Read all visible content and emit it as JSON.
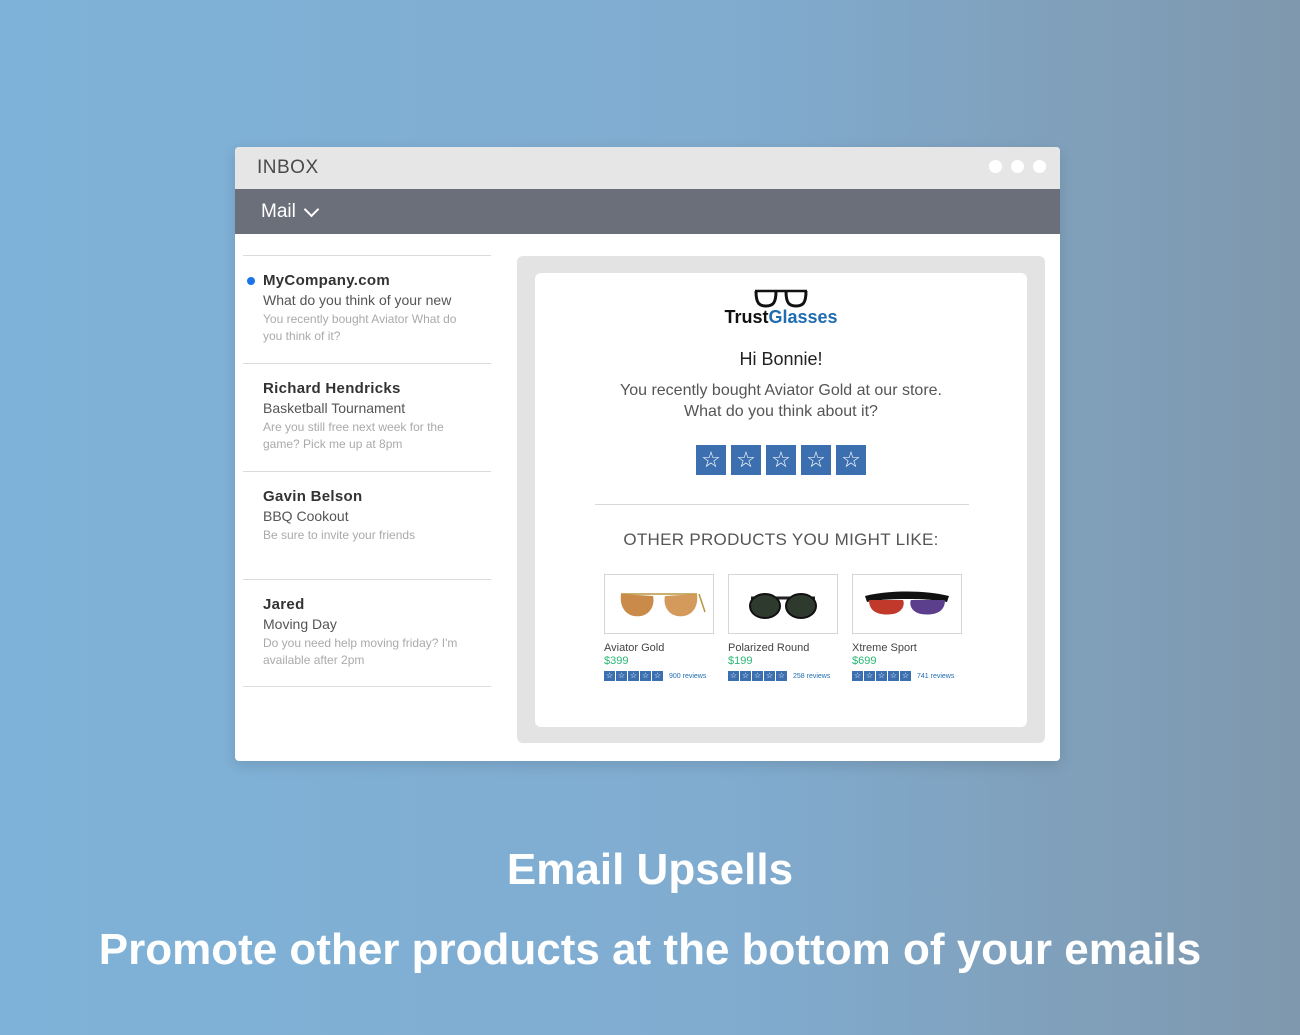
{
  "window": {
    "title": "INBOX",
    "menu_label": "Mail"
  },
  "messages": [
    {
      "from": "MyCompany.com",
      "subject": "What do you think of your new",
      "preview": "You recently bought Aviator What do you think of it?",
      "unread": true
    },
    {
      "from": "Richard Hendricks",
      "subject": "Basketball Tournament",
      "preview": "Are you still free next week for the game? Pick me up at 8pm",
      "unread": false
    },
    {
      "from": "Gavin Belson",
      "subject": "BBQ Cookout",
      "preview": "Be sure to invite your friends",
      "unread": false
    },
    {
      "from": "Jared",
      "subject": "Moving Day",
      "preview": "Do you need help moving friday? I'm available after 2pm",
      "unread": false
    }
  ],
  "email": {
    "brand_part1": "Trust",
    "brand_part2": "Glasses",
    "greeting": "Hi Bonnie!",
    "line1": "You recently bought Aviator Gold at our store.",
    "line2": "What do you think about it?",
    "rating_stars": 5,
    "other_heading": "OTHER PRODUCTS YOU MIGHT LIKE:",
    "products": [
      {
        "name": "Aviator Gold",
        "price": "$399",
        "reviews": "900 reviews",
        "image": "aviator-sunglasses"
      },
      {
        "name": "Polarized Round",
        "price": "$199",
        "reviews": "258 reviews",
        "image": "round-sunglasses"
      },
      {
        "name": "Xtreme Sport",
        "price": "$699",
        "reviews": "741 reviews",
        "image": "sport-sunglasses"
      }
    ]
  },
  "footer": {
    "headline": "Email Upsells",
    "subheadline": "Promote other products at the bottom of your emails"
  },
  "colors": {
    "accent": "#3b6fb0",
    "brand_blue": "#1f6db0",
    "price_green": "#2bb673",
    "menubar": "#6b6f7a"
  }
}
